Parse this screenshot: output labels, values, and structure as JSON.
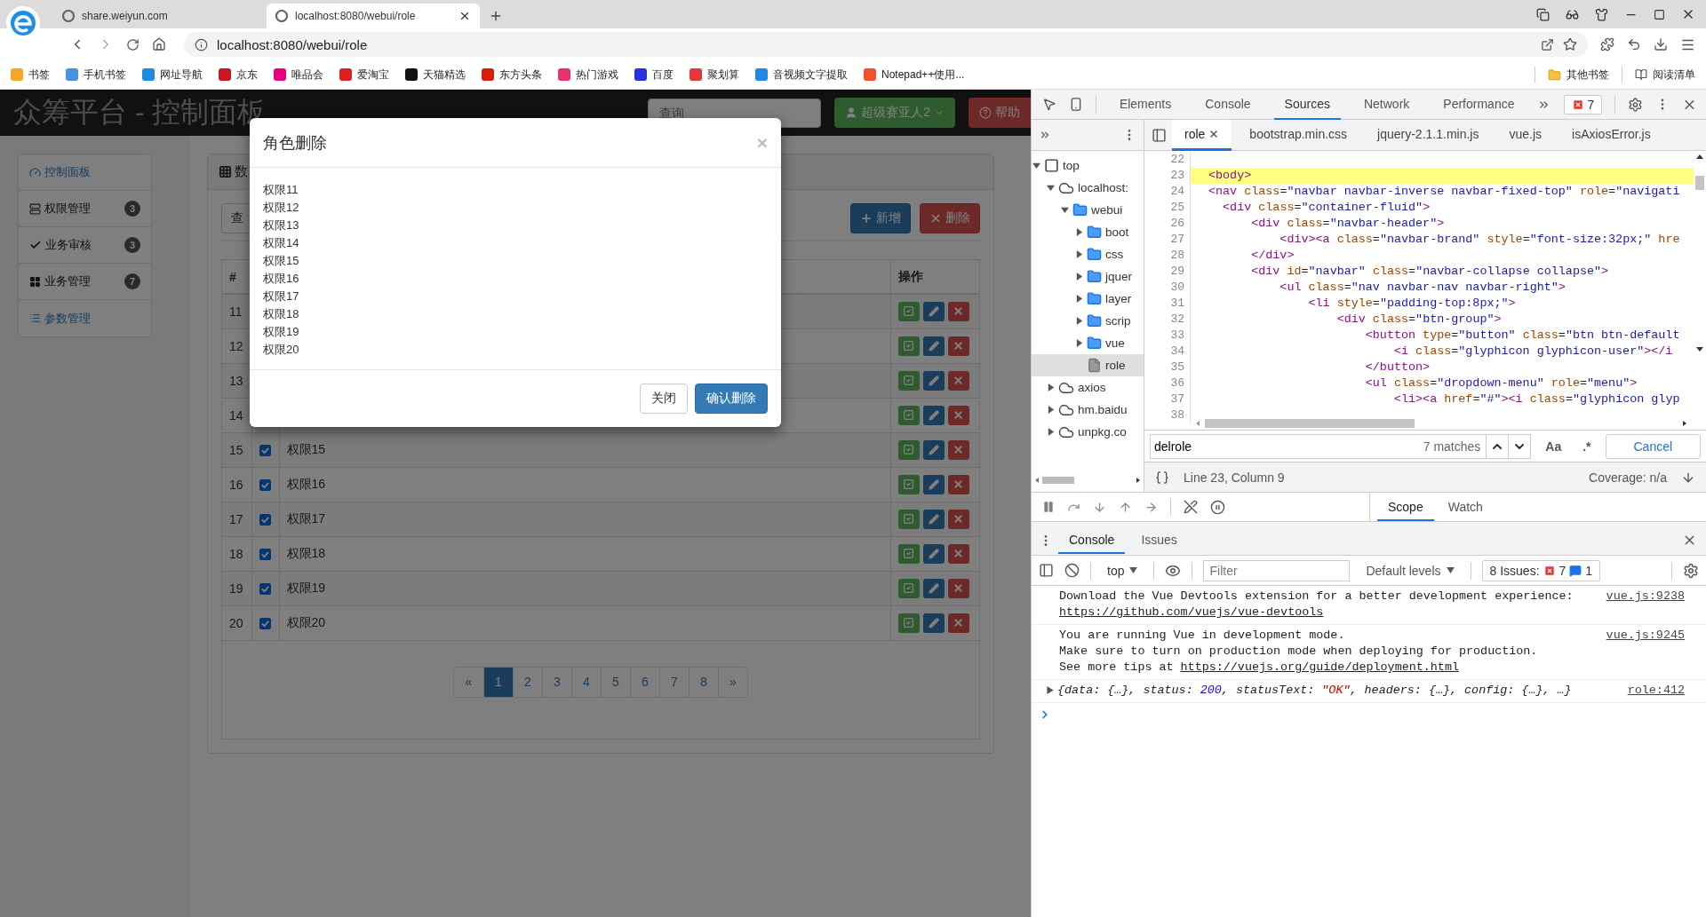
{
  "browser": {
    "tabs": [
      {
        "title": "share.weiyun.com",
        "selected": false
      },
      {
        "title": "localhost:8080/webui/role",
        "selected": true
      }
    ],
    "url": "localhost:8080/webui/role",
    "bookmarks": [
      {
        "label": "书签",
        "color": "#f5a623"
      },
      {
        "label": "手机书签",
        "color": "#4a90e2"
      },
      {
        "label": "网址导航",
        "color": "#1e88e5"
      },
      {
        "label": "京东",
        "color": "#c91623"
      },
      {
        "label": "唯品会",
        "color": "#e4007f"
      },
      {
        "label": "爱淘宝",
        "color": "#e02020"
      },
      {
        "label": "天猫精选",
        "color": "#111111"
      },
      {
        "label": "东方头条",
        "color": "#d81e06"
      },
      {
        "label": "热门游戏",
        "color": "#e6336e"
      },
      {
        "label": "百度",
        "color": "#2932e1"
      },
      {
        "label": "聚划算",
        "color": "#e4393c"
      },
      {
        "label": "音视频文字提取",
        "color": "#1e88e5"
      },
      {
        "label": "Notepad++使用...",
        "color": "#f0522b"
      }
    ],
    "bookmarks_right": [
      {
        "label": "其他书签",
        "kind": "folder"
      },
      {
        "label": "阅读清单",
        "kind": "list"
      }
    ]
  },
  "app": {
    "brand": "众筹平台 - 控制面板",
    "search": {
      "placeholder": "查询"
    },
    "user_button": "超级赛亚人2",
    "help_button": "帮助",
    "sidebar": [
      {
        "label": "控制面板",
        "kind": "link"
      },
      {
        "label": "权限管理",
        "kind": "menu",
        "badge": "3"
      },
      {
        "label": "业务审核",
        "kind": "menu",
        "badge": "3"
      },
      {
        "label": "业务管理",
        "kind": "menu",
        "badge": "7"
      },
      {
        "label": "参数管理",
        "kind": "link"
      }
    ],
    "panel": {
      "heading": "数",
      "query_button": "查",
      "add_button": "新增",
      "delete_button": "删除",
      "columns": [
        "#",
        "操作"
      ],
      "rows": [
        {
          "num": "11"
        },
        {
          "num": "12"
        },
        {
          "num": "13"
        },
        {
          "num": "14"
        },
        {
          "num": "15",
          "checked": true,
          "name": "权限15"
        },
        {
          "num": "16",
          "checked": true,
          "name": "权限16"
        },
        {
          "num": "17",
          "checked": true,
          "name": "权限17"
        },
        {
          "num": "18",
          "checked": true,
          "name": "权限18"
        },
        {
          "num": "19",
          "checked": true,
          "name": "权限19"
        },
        {
          "num": "20",
          "checked": true,
          "name": "权限20"
        }
      ],
      "pagination": [
        {
          "label": "«",
          "selected": false
        },
        {
          "label": "1",
          "selected": true
        },
        {
          "label": "2",
          "selected": false
        },
        {
          "label": "3",
          "selected": false
        },
        {
          "label": "4",
          "selected": false
        },
        {
          "label": "5",
          "selected": false
        },
        {
          "label": "6",
          "selected": false
        },
        {
          "label": "7",
          "selected": false
        },
        {
          "label": "8",
          "selected": false
        },
        {
          "label": "»",
          "selected": false
        }
      ]
    }
  },
  "dialog": {
    "title": "角色删除",
    "close": "×",
    "items": [
      "权限11",
      "权限12",
      "权限13",
      "权限14",
      "权限15",
      "权限16",
      "权限17",
      "权限18",
      "权限19",
      "权限20"
    ],
    "buttons": [
      {
        "label": "关闭",
        "kind": "default"
      },
      {
        "label": "确认删除",
        "kind": "primary"
      }
    ]
  },
  "devtools": {
    "tabs": [
      {
        "label": "Elements",
        "selected": false
      },
      {
        "label": "Console",
        "selected": false
      },
      {
        "label": "Sources",
        "selected": true
      },
      {
        "label": "Network",
        "selected": false
      },
      {
        "label": "Performance",
        "selected": false
      }
    ],
    "error_count": "7",
    "file_tabs": [
      {
        "label": "role",
        "selected": true
      },
      {
        "label": "bootstrap.min.css",
        "selected": false
      },
      {
        "label": "jquery-2.1.1.min.js",
        "selected": false
      },
      {
        "label": "vue.js",
        "selected": false
      },
      {
        "label": "isAxiosError.js",
        "selected": false
      }
    ],
    "tree": [
      {
        "label": "top",
        "kind": "frame",
        "expanded": true,
        "selected": false,
        "children": [
          {
            "label": "localhost:",
            "kind": "domain",
            "expanded": true,
            "selected": false,
            "children": [
              {
                "label": "webui",
                "kind": "folder",
                "expanded": true,
                "selected": false,
                "children": [
                  {
                    "label": "boot",
                    "kind": "folder",
                    "expanded": false,
                    "selected": false
                  },
                  {
                    "label": "css",
                    "kind": "folder",
                    "expanded": false,
                    "selected": false
                  },
                  {
                    "label": "jquer",
                    "kind": "folder",
                    "expanded": false,
                    "selected": false
                  },
                  {
                    "label": "layer",
                    "kind": "folder",
                    "expanded": false,
                    "selected": false
                  },
                  {
                    "label": "scrip",
                    "kind": "folder",
                    "expanded": false,
                    "selected": false
                  },
                  {
                    "label": "vue",
                    "kind": "folder",
                    "expanded": false,
                    "selected": false
                  },
                  {
                    "label": "role",
                    "kind": "file",
                    "selected": true
                  }
                ]
              }
            ]
          },
          {
            "label": "axios",
            "kind": "domain",
            "expanded": false,
            "selected": false
          },
          {
            "label": "hm.baidu",
            "kind": "domain",
            "expanded": false,
            "selected": false
          },
          {
            "label": "unpkg.co",
            "kind": "domain",
            "expanded": false,
            "selected": false
          }
        ]
      }
    ],
    "code": [
      {
        "number": "22",
        "highlighted": false
      },
      {
        "number": "23",
        "text": "<body>",
        "highlighted": true
      },
      {
        "number": "24",
        "text": "<nav class=\"navbar navbar-inverse navbar-fixed-top\" role=\"navigati",
        "highlighted": false
      },
      {
        "number": "25",
        "text": "  <div class=\"container-fluid\">",
        "highlighted": false
      },
      {
        "number": "26",
        "text": "      <div class=\"navbar-header\">",
        "highlighted": false
      },
      {
        "number": "27",
        "text": "          <div><a class=\"navbar-brand\" style=\"font-size:32px;\" hre",
        "highlighted": false
      },
      {
        "number": "28",
        "text": "      </div>",
        "highlighted": false
      },
      {
        "number": "29",
        "text": "      <div id=\"navbar\" class=\"navbar-collapse collapse\">",
        "highlighted": false
      },
      {
        "number": "30",
        "text": "          <ul class=\"nav navbar-nav navbar-right\">",
        "highlighted": false
      },
      {
        "number": "31",
        "text": "              <li style=\"padding-top:8px;\">",
        "highlighted": false
      },
      {
        "number": "32",
        "text": "                  <div class=\"btn-group\">",
        "highlighted": false
      },
      {
        "number": "33",
        "text": "                      <button type=\"button\" class=\"btn btn-default",
        "highlighted": false
      },
      {
        "number": "34",
        "text": "                          <i class=\"glyphicon glyphicon-user\"></i",
        "highlighted": false
      },
      {
        "number": "35",
        "text": "                      </button>",
        "highlighted": false
      },
      {
        "number": "36",
        "text": "                      <ul class=\"dropdown-menu\" role=\"menu\">",
        "highlighted": false
      },
      {
        "number": "37",
        "text": "                          <li><a href=\"#\"><i class=\"glyphicon glyp",
        "highlighted": false
      },
      {
        "number": "38",
        "highlighted": false
      }
    ],
    "search": {
      "value": "delrole",
      "matches": "7 matches",
      "case_button": "Aa",
      "regex_button": ".*",
      "cancel_button": "Cancel"
    },
    "status": {
      "position": "Line 23, Column 9",
      "coverage": "Coverage: n/a"
    },
    "debugger_tabs": [
      {
        "label": "Scope",
        "selected": true
      },
      {
        "label": "Watch",
        "selected": false
      }
    ],
    "drawer": {
      "tabs": [
        {
          "label": "Console",
          "selected": true
        },
        {
          "label": "Issues",
          "selected": false
        }
      ],
      "context": "top",
      "filter_placeholder": "Filter",
      "levels": "Default levels",
      "issues_label": "8 Issues:",
      "issues_errors": "7",
      "issues_info": "1",
      "messages": [
        {
          "kind": "text",
          "source": "vue.js:9238",
          "lines": [
            [
              {
                "text": "Download the Vue Devtools extension for a better development experience:",
                "link": false
              }
            ],
            [
              {
                "text": "https://github.com/vuejs/vue-devtools",
                "link": true
              }
            ]
          ]
        },
        {
          "kind": "text",
          "source": "vue.js:9245",
          "lines": [
            [
              {
                "text": "You are running Vue in development mode.",
                "link": false
              }
            ],
            [
              {
                "text": "Make sure to turn on production mode when deploying for production.",
                "link": false
              }
            ],
            [
              {
                "text": "See more tips at",
                "link": false
              },
              {
                "text": "https://vuejs.org/guide/deployment.html",
                "link": true
              }
            ]
          ]
        },
        {
          "kind": "object",
          "source": "role:412",
          "parts": [
            {
              "text": "{data: {…}, status: ",
              "kind": "plain"
            },
            {
              "text": "200",
              "kind": "number"
            },
            {
              "text": ", statusText: ",
              "kind": "plain"
            },
            {
              "text": "\"OK\"",
              "kind": "string"
            },
            {
              "text": ", headers: {…}, config: {…}, …}",
              "kind": "plain"
            }
          ]
        }
      ]
    }
  }
}
